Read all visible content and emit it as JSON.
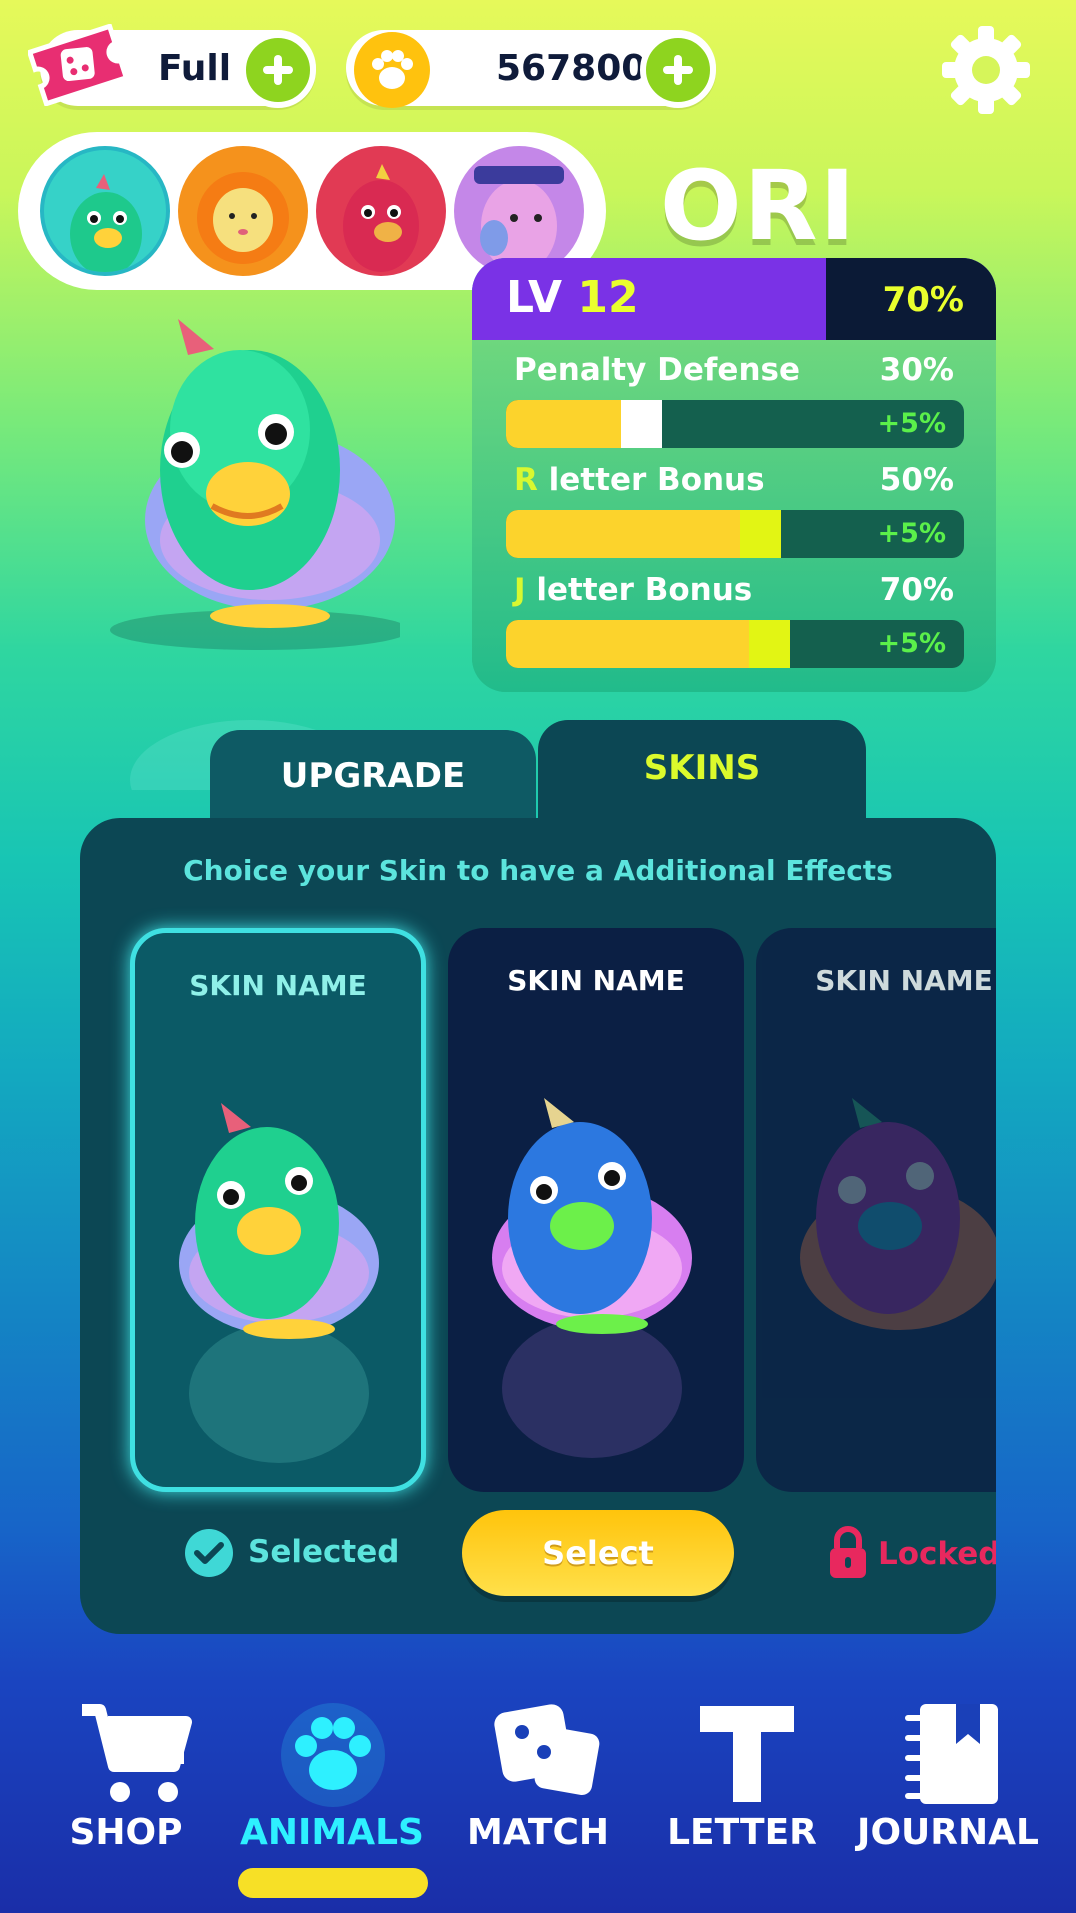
{
  "topbar": {
    "energy_value": "Full",
    "coins_value": "567800"
  },
  "character": {
    "name": "ORI",
    "level_prefix": "LV",
    "level": "12",
    "level_progress": "70%"
  },
  "stats": [
    {
      "label_prefix": "",
      "label": "Penalty Defense",
      "value": "30%",
      "bonus": "+5%",
      "fill": 0.25,
      "add": 0.09,
      "add_color": "#ffffff"
    },
    {
      "label_prefix": "R",
      "label": " letter Bonus",
      "value": "50%",
      "bonus": "+5%",
      "fill": 0.51,
      "add": 0.09,
      "add_color": "#e2f514"
    },
    {
      "label_prefix": "J",
      "label": " letter Bonus",
      "value": "70%",
      "bonus": "+5%",
      "fill": 0.53,
      "add": 0.09,
      "add_color": "#e2f514"
    }
  ],
  "tabs": {
    "upgrade": "UPGRADE",
    "skins": "SKINS"
  },
  "skins_panel": {
    "subtitle": "Choice your Skin to have a Additional Effects",
    "cards": [
      {
        "name": "SKIN NAME",
        "state": "Selected"
      },
      {
        "name": "SKIN NAME",
        "state": "Select"
      },
      {
        "name": "SKIN NAME",
        "state": "Locked"
      }
    ]
  },
  "nav": {
    "shop": "SHOP",
    "animals": "ANIMALS",
    "match": "MATCH",
    "letter": "LETTER",
    "journal": "JOURNAL"
  },
  "colors": {
    "accent_yellow": "#fcd32c",
    "panel": "#0c4754",
    "level_bar": "#7a32e6",
    "locked": "#e8285e",
    "active_nav": "#2ef0ff"
  }
}
